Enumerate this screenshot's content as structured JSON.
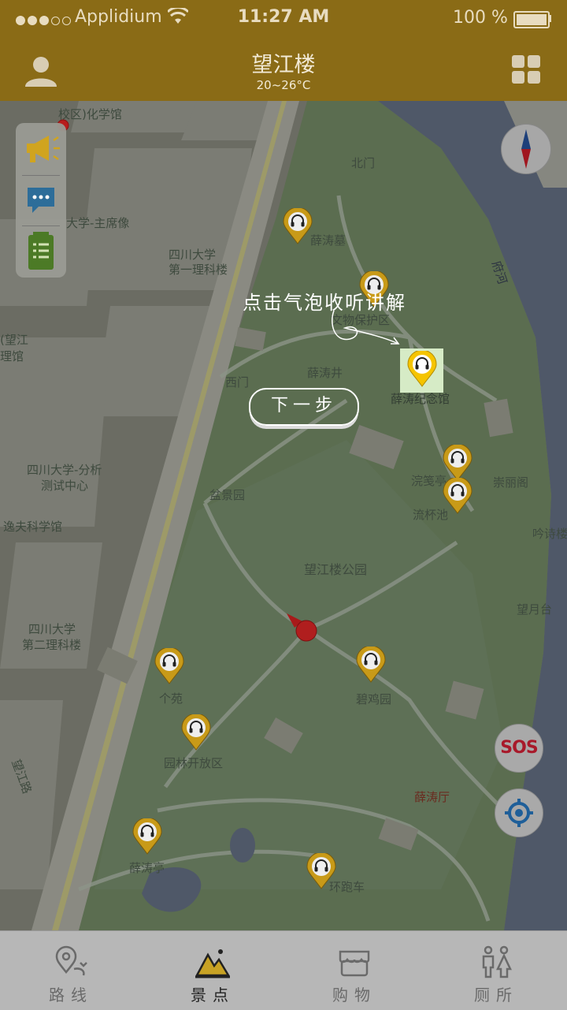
{
  "status_bar": {
    "carrier": "Applidium",
    "time": "11:27 AM",
    "battery": "100 %"
  },
  "header": {
    "title": "望江楼",
    "temperature": "20~26°C"
  },
  "map": {
    "labels": {
      "school_chem": "校区)化学馆",
      "chairman_statue": "大学-主席像",
      "physics1_a": "四川大学",
      "physics1_b": "第一理科楼",
      "wangjiang_a": "(望江",
      "wangjiang_b": "理馆",
      "analysis_a": "四川大学-分析",
      "analysis_b": "测试中心",
      "yifu": "逸夫科学馆",
      "physics2_a": "四川大学",
      "physics2_b": "第二理科楼",
      "road": "望江路",
      "river": "府河",
      "north_gate": "北门",
      "xuetao_tomb": "薛涛墓",
      "relic_area": "文物保护区",
      "xuetao_well": "薛涛井",
      "west_gate": "西门",
      "memorial": "薛涛纪念馆",
      "huanjian": "浣笺亭",
      "liubei": "流杯池",
      "chongli": "崇丽阁",
      "yinshi": "吟诗楼",
      "bonsai": "盆景园",
      "park": "望江楼公园",
      "wangyue": "望月台",
      "geyuan": "个苑",
      "biji": "碧鸡园",
      "garden_open": "园林开放区",
      "xuetao_hall": "薛涛厅",
      "xuetao_pavilion": "薛涛亭",
      "loop_cart": "环跑车"
    },
    "guide": {
      "hint": "点击气泡收听讲解",
      "next_button": "下一步"
    },
    "sos": "SOS"
  },
  "tabs": [
    {
      "label": "路线",
      "icon": "route-icon",
      "active": false
    },
    {
      "label": "景点",
      "icon": "scenic-mountain-icon",
      "active": true
    },
    {
      "label": "购物",
      "icon": "shop-icon",
      "active": false
    },
    {
      "label": "厕所",
      "icon": "toilet-icon",
      "active": false
    }
  ],
  "colors": {
    "header": "#8a6b16",
    "pin_gold": "#c89a18",
    "pin_highlight": "#f5c400",
    "user_dot": "#c21a1a",
    "sos_red": "#a8192a"
  }
}
